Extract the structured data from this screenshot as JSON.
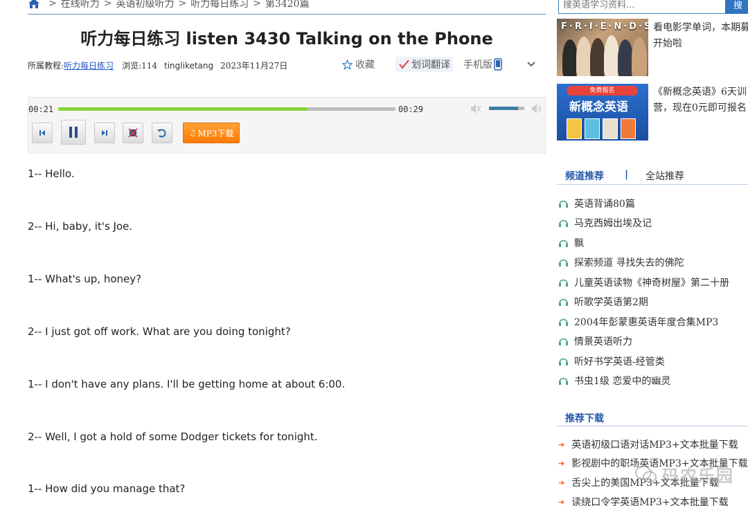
{
  "breadcrumb": {
    "items": [
      "在线听力",
      "英语初级听力",
      "听力每日练习",
      "第3420篇"
    ],
    "separator": ">"
  },
  "article": {
    "title": "听力每日练习 listen 3430 Talking on the Phone",
    "category_label": "所属教程:",
    "category_link": "听力每日练习",
    "views": "浏览:114",
    "author": "tingliketang",
    "date": "2023年11月27日"
  },
  "actions": {
    "favorite": "收藏",
    "translate": "划词翻译",
    "mobile": "手机版"
  },
  "player": {
    "current_time": "00:21",
    "duration": "00:29",
    "progress_fraction": 0.74,
    "volume_fraction": 0.82,
    "mp3_label": "MP3下载"
  },
  "transcript": [
    "1-- Hello.",
    "2-- Hi, baby, it's Joe.",
    "1-- What's up, honey?",
    "2-- I just got off work. What are you doing tonight?",
    "1-- I don't have any plans. I'll be getting home at about 6:00.",
    "2-- Well, I got a hold of some Dodger tickets for tonight.",
    "1-- How did you manage that?"
  ],
  "search": {
    "placeholder": "搜英语学习资料...",
    "button": "搜"
  },
  "ads": [
    {
      "image_text": "F·R·I·E·N·D·S",
      "text": "看电影学单词，本期募开始啦"
    },
    {
      "badge": "免费报名",
      "headline": "新概念英语",
      "text": "《新概念英语》6天训营，现在0元即可报名"
    }
  ],
  "tabs": {
    "channel": "频道推荐",
    "divider": "|",
    "site": "全站推荐"
  },
  "recommendations": [
    "英语背诵80篇",
    "马克西姆出埃及记",
    "飘",
    "探索频道 寻找失去的佛陀",
    "儿童英语读物《神奇树屋》第二十册",
    "听歌学英语第2期",
    "2004年彭蒙惠英语年度合集MP3",
    "情景英语听力",
    "听好书学英语-经管类",
    "书虫1级 恋爱中的幽灵"
  ],
  "downloads": {
    "heading": "推荐下载",
    "items": [
      "英语初级口语对话MP3+文本批量下载",
      "影视剧中的职场英语MP3+文本批量下载",
      "舌尖上的美国MP3+文本批量下载",
      "读绕口令学英语MP3+文本批量下载"
    ]
  },
  "watermark": "码农乐园",
  "colors": {
    "accent_blue": "#2458a8",
    "progress_green": "#86d63a",
    "mp3_orange": "#ff7a00",
    "download_arrow": "#ff5a1f"
  }
}
